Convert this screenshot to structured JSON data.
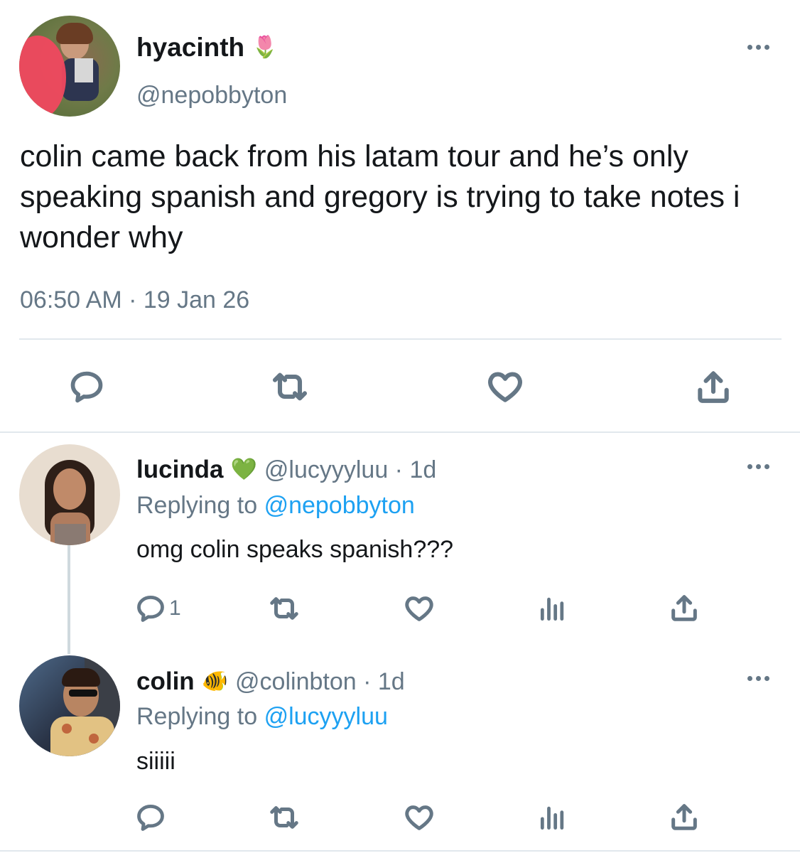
{
  "main_tweet": {
    "display_name": "hyacinth",
    "name_emoji": "🌷",
    "handle": "@nepobbyton",
    "text": "colin came back from his latam tour and he’s only speaking spanish and gregory is trying to take notes i wonder why",
    "timestamp": "06:50 AM · 19 Jan 26",
    "actions": [
      "reply-icon",
      "retweet-icon",
      "like-icon",
      "share-icon"
    ]
  },
  "replies": [
    {
      "display_name": "lucinda",
      "name_emoji": "💚",
      "handle_time": "@lucyyyluu · 1d",
      "replying_label": "Replying to",
      "replying_to": "@nepobbyton",
      "text": "omg colin speaks spanish???",
      "reply_count": "1",
      "actions": [
        "reply-icon",
        "retweet-icon",
        "like-icon",
        "analytics-icon",
        "share-icon"
      ]
    },
    {
      "display_name": "colin",
      "name_emoji": "🐠",
      "handle_time": "@colinbton · 1d",
      "replying_label": "Replying to",
      "replying_to": "@lucyyyluu",
      "text": "siiiii",
      "reply_count": "",
      "actions": [
        "reply-icon",
        "retweet-icon",
        "like-icon",
        "analytics-icon",
        "share-icon"
      ]
    }
  ],
  "colors": {
    "text": "#14171a",
    "muted": "#657786",
    "link": "#1da1f2",
    "divider": "#e1e8ed"
  }
}
